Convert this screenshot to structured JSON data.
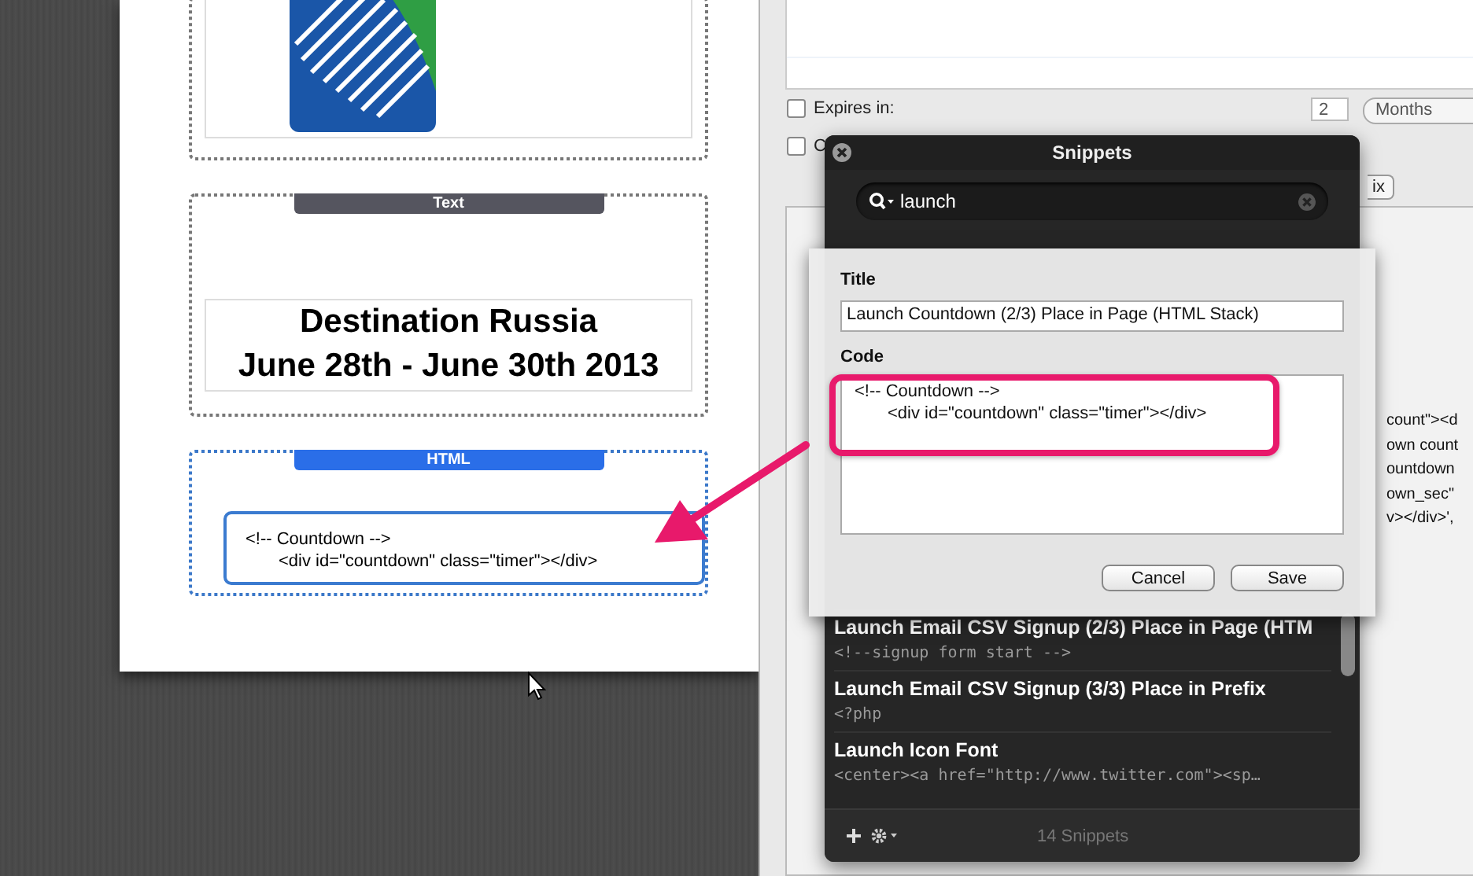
{
  "page": {
    "blocks": [
      {
        "kind": "image"
      },
      {
        "kind": "text",
        "label": "Text",
        "lines": [
          "Destination Russia",
          "June 28th - June 30th 2013"
        ]
      },
      {
        "kind": "html",
        "label": "HTML",
        "code_lines": [
          "<!-- Countdown -->",
          "<div id=\"countdown\" class=\"timer\"></div>"
        ]
      }
    ]
  },
  "settings": {
    "rows": [
      {
        "label": "Expires in:",
        "checked": false
      },
      {
        "label": "C",
        "checked": false
      }
    ],
    "expires_value": "2",
    "expires_unit": "Months",
    "button_fragment": "ix",
    "code_fragments": [
      "count\"><d",
      "own count",
      "ountdown",
      "own_sec\"",
      "v></div>',"
    ]
  },
  "snippets": {
    "title": "Snippets",
    "search": "launch",
    "items": [
      {
        "title": "Launch Email CSV Signup (2/3) Place in Page (HTM",
        "preview": "<!--signup form start -->"
      },
      {
        "title": "Launch Email CSV Signup (3/3) Place in Prefix",
        "preview": "<?php"
      },
      {
        "title": "Launch Icon Font",
        "preview": "<center><a href=\"http://www.twitter.com\"><sp…"
      }
    ],
    "count": "14 Snippets"
  },
  "sheet": {
    "title_label": "Title",
    "title_value": "Launch Countdown (2/3) Place in Page (HTML Stack)",
    "code_label": "Code",
    "code_lines": [
      "<!-- Countdown -->",
      "<div id=\"countdown\" class=\"timer\"></div>"
    ],
    "buttons": [
      "Cancel",
      "Save"
    ]
  }
}
